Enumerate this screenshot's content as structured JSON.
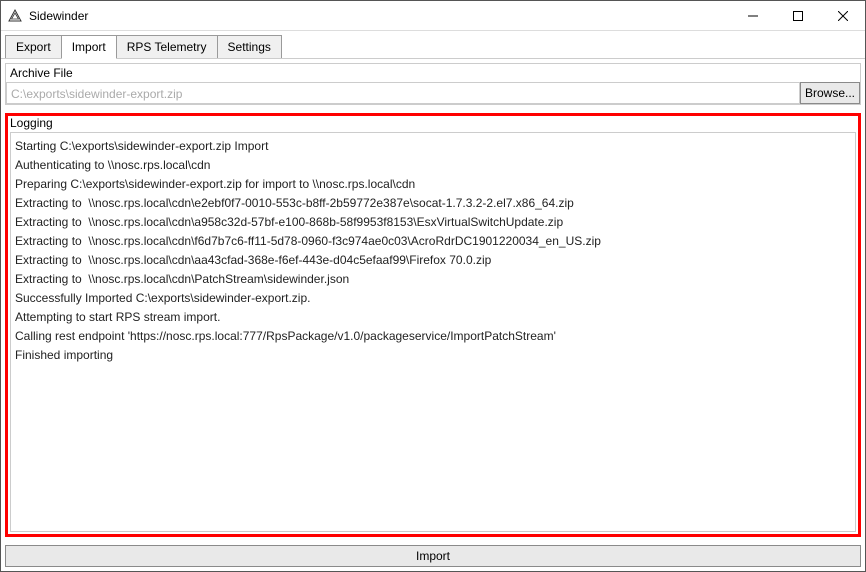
{
  "window": {
    "title": "Sidewinder"
  },
  "tabs": {
    "export": "Export",
    "import": "Import",
    "telemetry": "RPS Telemetry",
    "settings": "Settings"
  },
  "archive": {
    "group_label": "Archive File",
    "path": "C:\\exports\\sidewinder-export.zip",
    "browse_label": "Browse..."
  },
  "logging": {
    "group_label": "Logging",
    "lines": [
      "Starting C:\\exports\\sidewinder-export.zip Import",
      "Authenticating to \\\\nosc.rps.local\\cdn",
      "Preparing C:\\exports\\sidewinder-export.zip for import to \\\\nosc.rps.local\\cdn",
      "Extracting to  \\\\nosc.rps.local\\cdn\\e2ebf0f7-0010-553c-b8ff-2b59772e387e\\socat-1.7.3.2-2.el7.x86_64.zip",
      "Extracting to  \\\\nosc.rps.local\\cdn\\a958c32d-57bf-e100-868b-58f9953f8153\\EsxVirtualSwitchUpdate.zip",
      "Extracting to  \\\\nosc.rps.local\\cdn\\f6d7b7c6-ff11-5d78-0960-f3c974ae0c03\\AcroRdrDC1901220034_en_US.zip",
      "Extracting to  \\\\nosc.rps.local\\cdn\\aa43cfad-368e-f6ef-443e-d04c5efaaf99\\Firefox 70.0.zip",
      "Extracting to  \\\\nosc.rps.local\\cdn\\PatchStream\\sidewinder.json",
      "Successfully Imported C:\\exports\\sidewinder-export.zip.",
      "Attempting to start RPS stream import.",
      "Calling rest endpoint 'https://nosc.rps.local:777/RpsPackage/v1.0/packageservice/ImportPatchStream'",
      "Finished importing"
    ]
  },
  "buttons": {
    "import": "Import"
  }
}
